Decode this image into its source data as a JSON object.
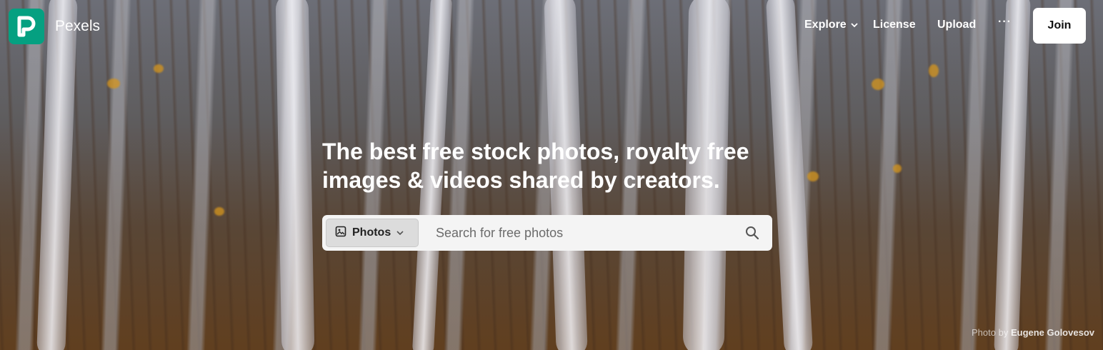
{
  "brand": {
    "name": "Pexels"
  },
  "nav": {
    "explore_label": "Explore",
    "license_label": "License",
    "upload_label": "Upload",
    "more_label": "···",
    "join_label": "Join"
  },
  "hero": {
    "headline_line1": "The best free stock photos, royalty free",
    "headline_line2": "images & videos shared by creators."
  },
  "search": {
    "type_label": "Photos",
    "placeholder": "Search for free photos",
    "value": ""
  },
  "credit": {
    "prefix": "Photo by",
    "author": "Eugene Golovesov"
  },
  "icons": {
    "logo": "pexels-logo-icon",
    "explore_chevron": "chevron-down-icon",
    "more": "more-dots-icon",
    "type": "image-icon",
    "type_chevron": "chevron-down-icon",
    "search": "search-icon"
  },
  "colors": {
    "brand": "#05a081",
    "button": "#ffffff",
    "search_bg": "#f4f4f4"
  }
}
